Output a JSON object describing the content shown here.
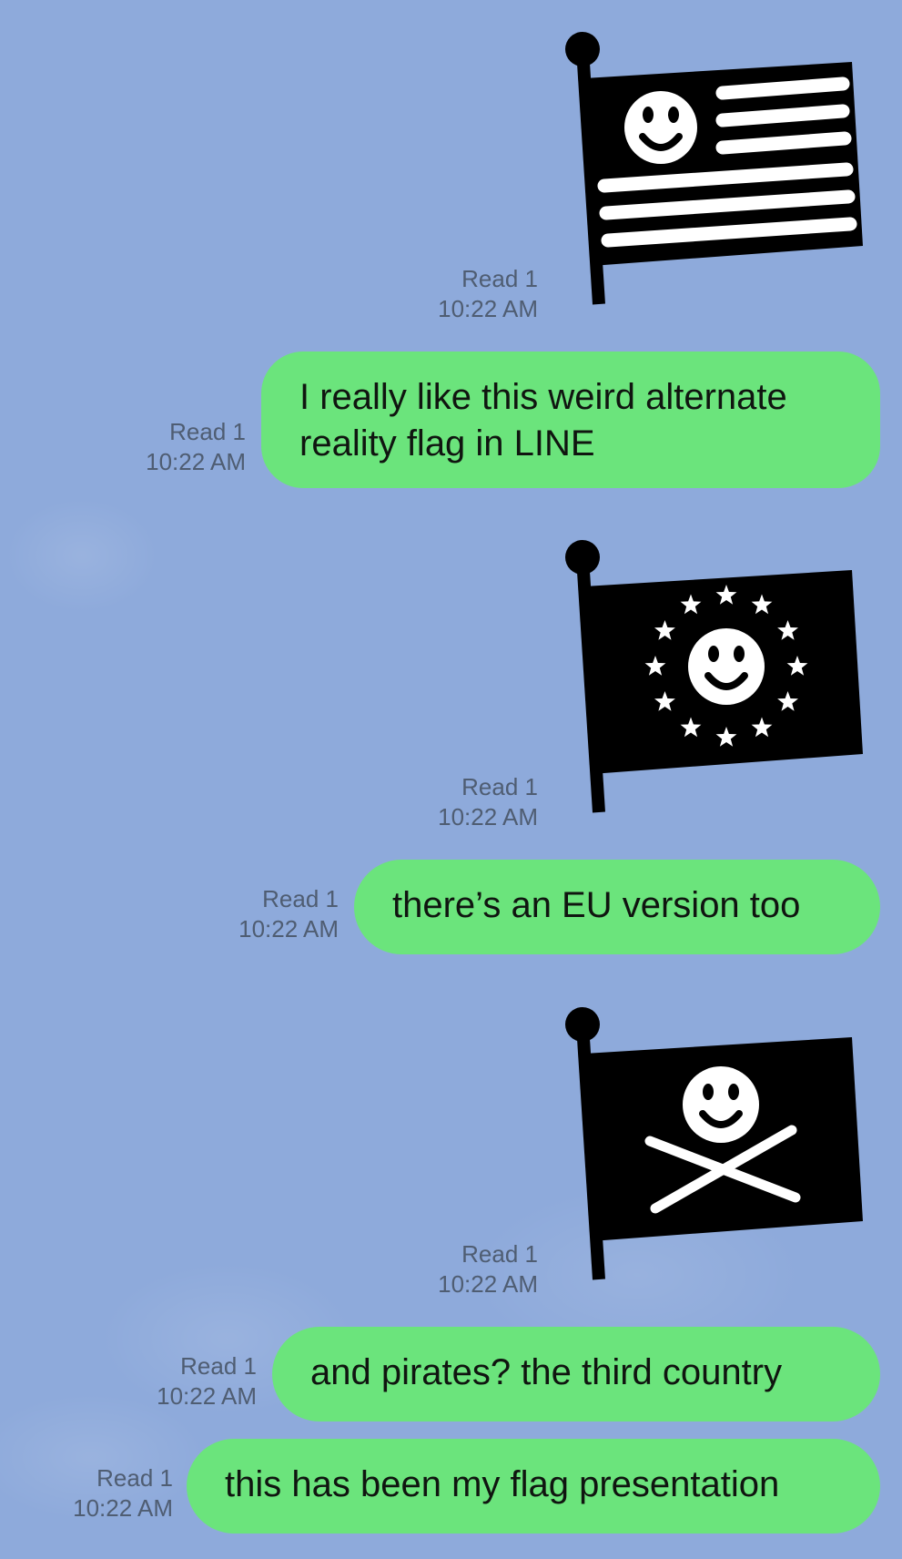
{
  "messages": [
    {
      "type": "sticker",
      "icon": "smiley-stripes-flag-icon",
      "read": "Read 1",
      "time": "10:22 AM"
    },
    {
      "type": "text",
      "lines": [
        "I really like this weird alternate",
        "reality flag in LINE"
      ],
      "read": "Read 1",
      "time": "10:22 AM"
    },
    {
      "type": "sticker",
      "icon": "smiley-eu-stars-flag-icon",
      "read": "Read 1",
      "time": "10:22 AM"
    },
    {
      "type": "text",
      "lines": [
        "there’s an EU version too"
      ],
      "read": "Read 1",
      "time": "10:22 AM"
    },
    {
      "type": "sticker",
      "icon": "smiley-pirate-flag-icon",
      "read": "Read 1",
      "time": "10:22 AM"
    },
    {
      "type": "text",
      "lines": [
        "and pirates? the third country"
      ],
      "read": "Read 1",
      "time": "10:22 AM"
    },
    {
      "type": "text",
      "lines": [
        "this has been my flag presentation"
      ],
      "read": "Read 1",
      "time": "10:22 AM"
    }
  ],
  "colors": {
    "background": "#8eaadb",
    "bubble": "#6be47c",
    "meta_text": "#4f5d72",
    "flag": "#000000"
  }
}
